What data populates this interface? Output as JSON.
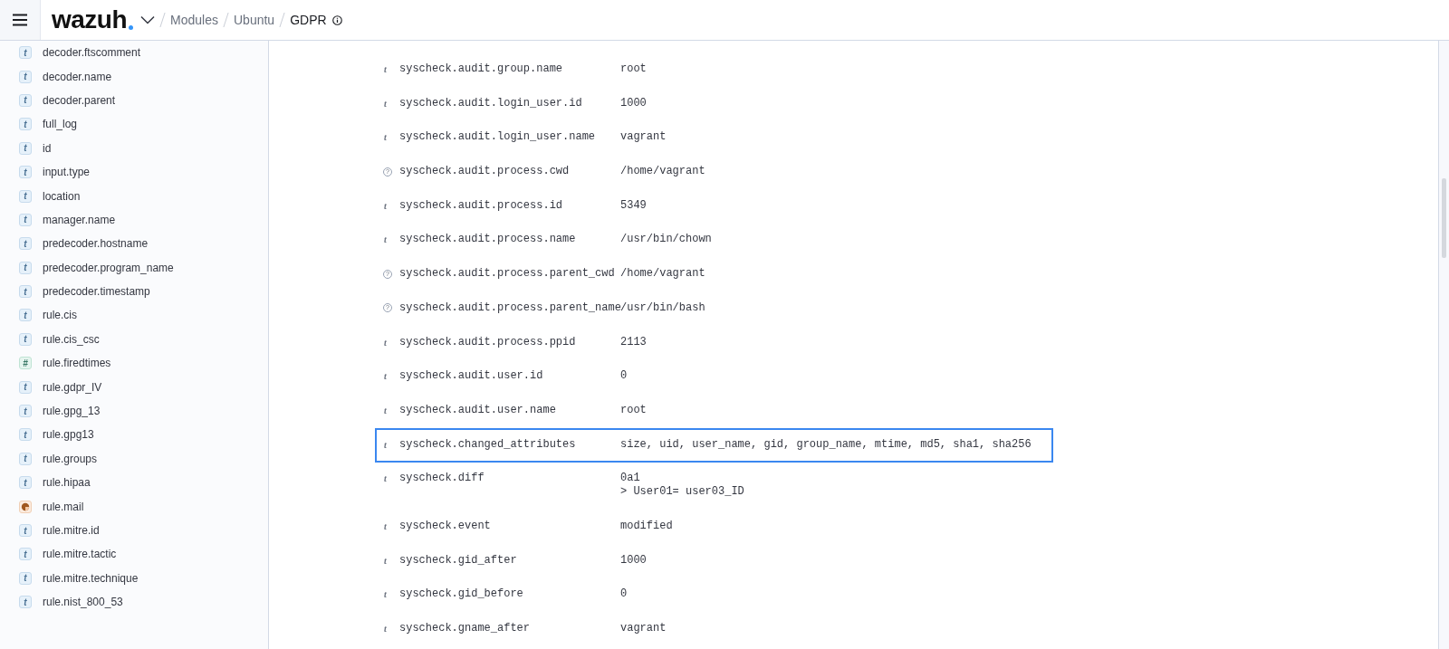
{
  "header": {
    "logo": "wazuh",
    "breadcrumbs": [
      {
        "label": "Modules",
        "current": false
      },
      {
        "label": "Ubuntu",
        "current": false
      },
      {
        "label": "GDPR",
        "current": true
      }
    ]
  },
  "sidebar": {
    "fields": [
      {
        "name": "decoder.ftscomment",
        "kind": "string",
        "glyph": "t"
      },
      {
        "name": "decoder.name",
        "kind": "string",
        "glyph": "t"
      },
      {
        "name": "decoder.parent",
        "kind": "string",
        "glyph": "t"
      },
      {
        "name": "full_log",
        "kind": "string",
        "glyph": "t"
      },
      {
        "name": "id",
        "kind": "string",
        "glyph": "t"
      },
      {
        "name": "input.type",
        "kind": "string",
        "glyph": "t"
      },
      {
        "name": "location",
        "kind": "string",
        "glyph": "t"
      },
      {
        "name": "manager.name",
        "kind": "string",
        "glyph": "t"
      },
      {
        "name": "predecoder.hostname",
        "kind": "string",
        "glyph": "t"
      },
      {
        "name": "predecoder.program_name",
        "kind": "string",
        "glyph": "t"
      },
      {
        "name": "predecoder.timestamp",
        "kind": "string",
        "glyph": "t"
      },
      {
        "name": "rule.cis",
        "kind": "string",
        "glyph": "t"
      },
      {
        "name": "rule.cis_csc",
        "kind": "string",
        "glyph": "t"
      },
      {
        "name": "rule.firedtimes",
        "kind": "number",
        "glyph": "#"
      },
      {
        "name": "rule.gdpr_IV",
        "kind": "string",
        "glyph": "t"
      },
      {
        "name": "rule.gpg_13",
        "kind": "string",
        "glyph": "t"
      },
      {
        "name": "rule.gpg13",
        "kind": "string",
        "glyph": "t"
      },
      {
        "name": "rule.groups",
        "kind": "string",
        "glyph": "t"
      },
      {
        "name": "rule.hipaa",
        "kind": "string",
        "glyph": "t"
      },
      {
        "name": "rule.mail",
        "kind": "boolean"
      },
      {
        "name": "rule.mitre.id",
        "kind": "string",
        "glyph": "t"
      },
      {
        "name": "rule.mitre.tactic",
        "kind": "string",
        "glyph": "t"
      },
      {
        "name": "rule.mitre.technique",
        "kind": "string",
        "glyph": "t"
      },
      {
        "name": "rule.nist_800_53",
        "kind": "string",
        "glyph": "t"
      }
    ]
  },
  "document": {
    "rows": [
      {
        "kind": "string",
        "glyph": "t",
        "field": "syscheck.audit.group.name",
        "value": [
          "root"
        ],
        "highlighted": false
      },
      {
        "kind": "string",
        "glyph": "t",
        "field": "syscheck.audit.login_user.id",
        "value": [
          "1000"
        ],
        "highlighted": false
      },
      {
        "kind": "string",
        "glyph": "t",
        "field": "syscheck.audit.login_user.name",
        "value": [
          "vagrant"
        ],
        "highlighted": false
      },
      {
        "kind": "unknown",
        "glyph": "?",
        "field": "syscheck.audit.process.cwd",
        "value": [
          "/home/vagrant"
        ],
        "highlighted": false
      },
      {
        "kind": "string",
        "glyph": "t",
        "field": "syscheck.audit.process.id",
        "value": [
          "5349"
        ],
        "highlighted": false
      },
      {
        "kind": "string",
        "glyph": "t",
        "field": "syscheck.audit.process.name",
        "value": [
          "/usr/bin/chown"
        ],
        "highlighted": false
      },
      {
        "kind": "unknown",
        "glyph": "?",
        "field": "syscheck.audit.process.parent_cwd",
        "value": [
          "/home/vagrant"
        ],
        "highlighted": false
      },
      {
        "kind": "unknown",
        "glyph": "?",
        "field": "syscheck.audit.process.parent_name",
        "value": [
          "/usr/bin/bash"
        ],
        "highlighted": false
      },
      {
        "kind": "string",
        "glyph": "t",
        "field": "syscheck.audit.process.ppid",
        "value": [
          "2113"
        ],
        "highlighted": false
      },
      {
        "kind": "string",
        "glyph": "t",
        "field": "syscheck.audit.user.id",
        "value": [
          "0"
        ],
        "highlighted": false
      },
      {
        "kind": "string",
        "glyph": "t",
        "field": "syscheck.audit.user.name",
        "value": [
          "root"
        ],
        "highlighted": false
      },
      {
        "kind": "string",
        "glyph": "t",
        "field": "syscheck.changed_attributes",
        "value": [
          "size, uid, user_name, gid, group_name, mtime, md5, sha1, sha256"
        ],
        "highlighted": true
      },
      {
        "kind": "string",
        "glyph": "t",
        "field": "syscheck.diff",
        "value": [
          "0a1",
          "> User01= user03_ID"
        ],
        "highlighted": false
      },
      {
        "kind": "string",
        "glyph": "t",
        "field": "syscheck.event",
        "value": [
          "modified"
        ],
        "highlighted": false
      },
      {
        "kind": "string",
        "glyph": "t",
        "field": "syscheck.gid_after",
        "value": [
          "1000"
        ],
        "highlighted": false
      },
      {
        "kind": "string",
        "glyph": "t",
        "field": "syscheck.gid_before",
        "value": [
          "0"
        ],
        "highlighted": false
      },
      {
        "kind": "string",
        "glyph": "t",
        "field": "syscheck.gname_after",
        "value": [
          "vagrant"
        ],
        "highlighted": false
      }
    ]
  }
}
